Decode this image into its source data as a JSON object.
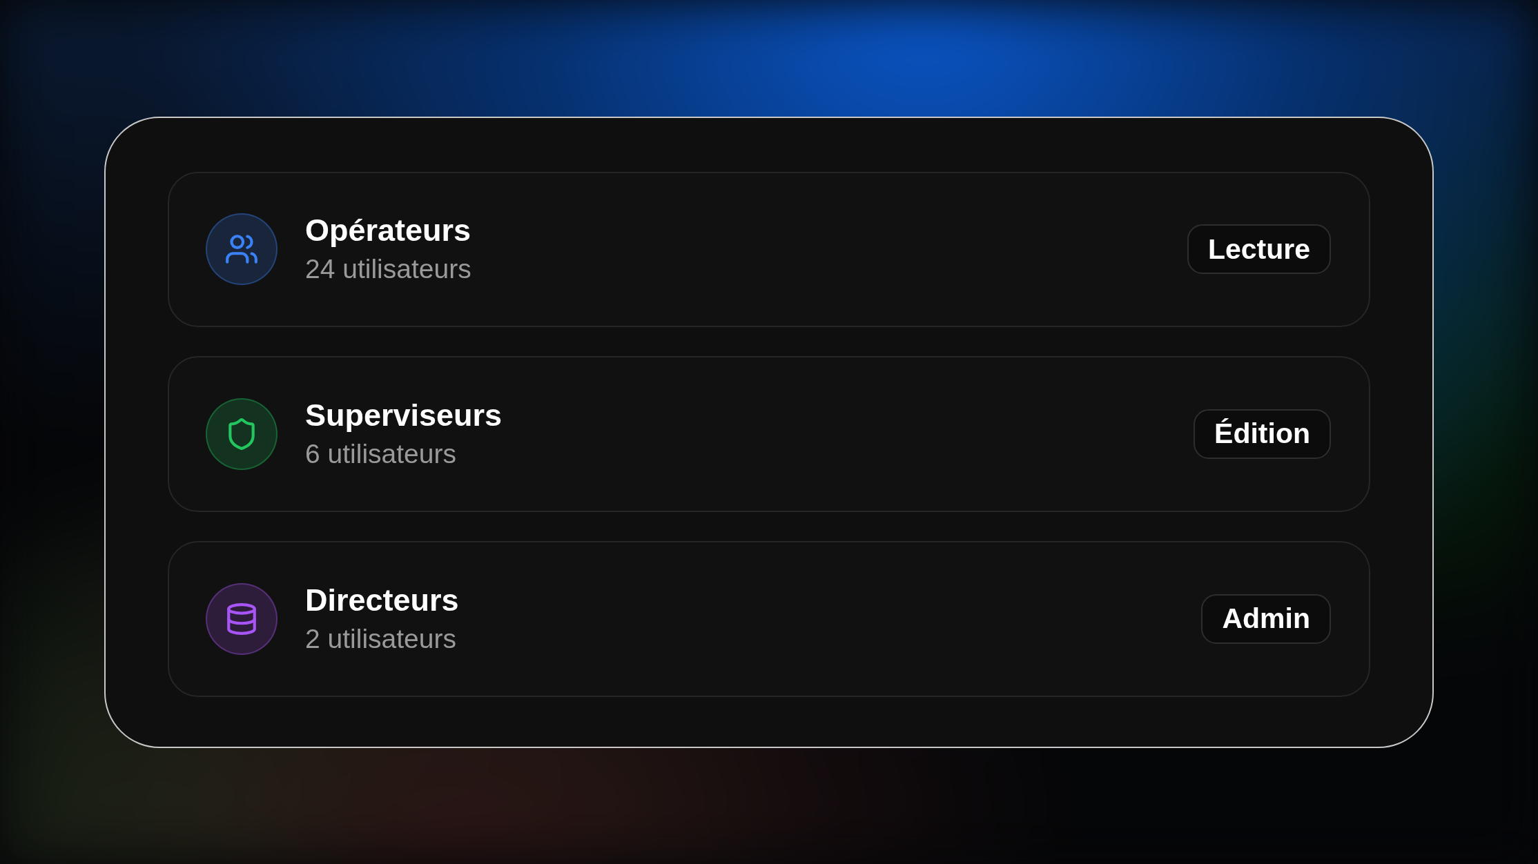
{
  "groups": [
    {
      "name": "Opérateurs",
      "count": "24 utilisateurs",
      "kind": "users",
      "color": "#3b82f6",
      "access": "Lecture"
    },
    {
      "name": "Superviseurs",
      "count": "6 utilisateurs",
      "kind": "shield",
      "color": "#22c55e",
      "access": "Édition"
    },
    {
      "name": "Directeurs",
      "count": "2 utilisateurs",
      "kind": "database",
      "color": "#a855f7",
      "access": "Admin"
    }
  ]
}
